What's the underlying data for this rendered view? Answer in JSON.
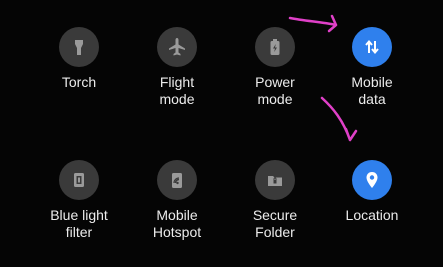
{
  "colors": {
    "background": "#050505",
    "tile_off": "#3a3a3a",
    "tile_on": "#2f80ed",
    "icon_off": "#9a9a9a",
    "icon_on": "#ffffff",
    "label": "#ececec",
    "annotation": "#e040c8"
  },
  "quick_settings": {
    "tiles": [
      {
        "label": "Torch",
        "icon": "torch-icon",
        "state": "off"
      },
      {
        "label": "Flight\nmode",
        "icon": "airplane-icon",
        "state": "off"
      },
      {
        "label": "Power\nmode",
        "icon": "battery-icon",
        "state": "off"
      },
      {
        "label": "Mobile\ndata",
        "icon": "mobile-data-arrows-icon",
        "state": "on"
      },
      {
        "label": "Blue light\nfilter",
        "icon": "blue-light-filter-icon",
        "state": "off"
      },
      {
        "label": "Mobile\nHotspot",
        "icon": "hotspot-icon",
        "state": "off"
      },
      {
        "label": "Secure\nFolder",
        "icon": "secure-folder-icon",
        "state": "off"
      },
      {
        "label": "Location",
        "icon": "location-pin-icon",
        "state": "on"
      }
    ]
  }
}
